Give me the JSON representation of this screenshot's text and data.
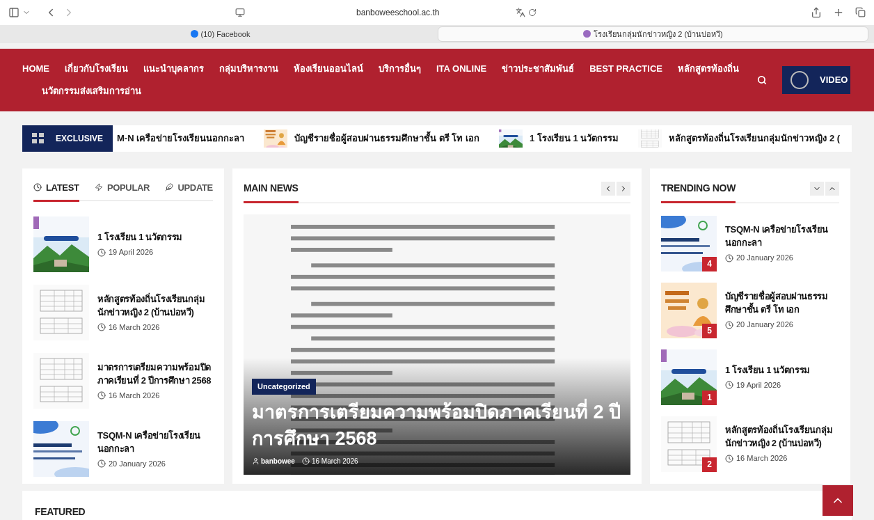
{
  "browser": {
    "url": "banboweeschool.ac.th",
    "tabs": [
      {
        "title": "(10) Facebook",
        "selected": false
      },
      {
        "title": "โรงเรียนกลุ่มนักข่าวหญิง 2 (บ้านบ่อหวี)",
        "selected": true
      }
    ]
  },
  "nav": {
    "items": [
      {
        "label": "HOME"
      },
      {
        "label": "เกี่ยวกับโรงเรียน"
      },
      {
        "label": "แนะนำบุคลากร"
      },
      {
        "label": "กลุ่มบริหารงาน"
      },
      {
        "label": "ห้องเรียนออนไลน์"
      },
      {
        "label": "บริการอื่นๆ"
      },
      {
        "label": "ITA ONLINE"
      },
      {
        "label": "ข่าวประชาสัมพันธ์"
      },
      {
        "label": "BEST PRACTICE"
      },
      {
        "label": "หลักสูตรท้องถิ่น"
      },
      {
        "label": "นวัตกรรมส่งเสริมการอ่าน"
      }
    ],
    "video_label": "VIDEO"
  },
  "exclusive": {
    "label": "EXCLUSIVE",
    "items": [
      {
        "title": "M-N เครือข่ายโรงเรียนนอกกะลา",
        "thumb": false
      },
      {
        "title": "บัญชีรายชื่อผู้สอบผ่านธรรมศึกษาชั้น ตรี โท เอก",
        "thumb": true
      },
      {
        "title": "1 โรงเรียน 1 นวัตกรรม",
        "thumb": true
      },
      {
        "title": "หลักสูตรท้องถิ่นโรงเรียนกลุ่มนักข่าวหญิง 2 (",
        "thumb": true
      }
    ]
  },
  "latest": {
    "tabs": [
      {
        "label": "LATEST",
        "selected": true
      },
      {
        "label": "POPULAR",
        "selected": false
      },
      {
        "label": "UPDATE",
        "selected": false
      }
    ],
    "posts": [
      {
        "title": "1 โรงเรียน 1 นวัตกรรม",
        "date": "19 April 2026"
      },
      {
        "title": "หลักสูตรท้องถิ่นโรงเรียนกลุ่มนักข่าวหญิง 2 (บ้านบ่อหวี)",
        "date": "16 March 2026"
      },
      {
        "title": "มาตรการเตรียมความพร้อมปิดภาคเรียนที่ 2 ปีการศึกษา 2568",
        "date": "16 March 2026"
      },
      {
        "title": "TSQM-N เครือข่ายโรงเรียนนอกกะลา",
        "date": "20 January 2026"
      }
    ]
  },
  "main_news": {
    "heading": "MAIN NEWS",
    "category": "Uncategorized",
    "title": "มาตรการเตรียมความพร้อมปิดภาคเรียนที่ 2 ปีการศึกษา 2568",
    "author": "banbowee",
    "date": "16 March 2026"
  },
  "trending": {
    "heading": "TRENDING NOW",
    "posts": [
      {
        "title": "TSQM-N เครือข่ายโรงเรียนนอกกะลา",
        "date": "20 January 2026",
        "rank": "4"
      },
      {
        "title": "บัญชีรายชื่อผู้สอบผ่านธรรมศึกษาชั้น ตรี โท เอก",
        "date": "20 January 2026",
        "rank": "5"
      },
      {
        "title": "1 โรงเรียน 1 นวัตกรรม",
        "date": "19 April 2026",
        "rank": "1"
      },
      {
        "title": "หลักสูตรท้องถิ่นโรงเรียนกลุ่มนักข่าวหญิง 2 (บ้านบ่อหวี)",
        "date": "16 March 2026",
        "rank": "2"
      }
    ]
  },
  "featured": {
    "heading": "FEATURED"
  }
}
